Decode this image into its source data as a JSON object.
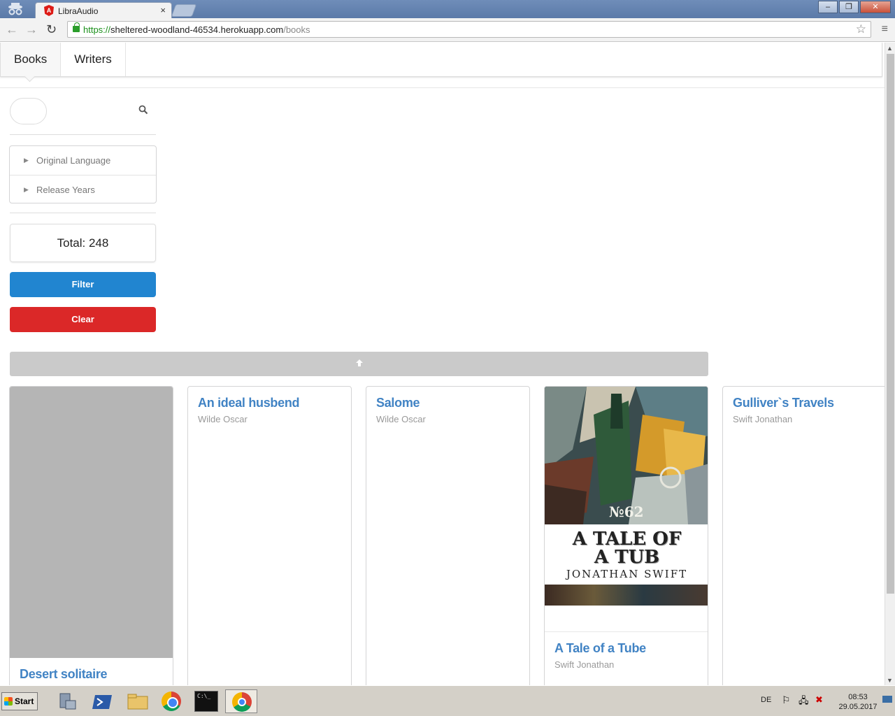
{
  "browser": {
    "tab_title": "LibraAudio",
    "tab_close": "×",
    "url_scheme": "https://",
    "url_host": "sheltered-woodland-46534.herokuapp.com",
    "url_path": "/books"
  },
  "nav": {
    "items": [
      {
        "label": "Books",
        "active": true
      },
      {
        "label": "Writers",
        "active": false
      }
    ]
  },
  "sidebar": {
    "search_placeholder": "",
    "filters": [
      {
        "label": "Original Language"
      },
      {
        "label": "Release Years"
      }
    ],
    "total_label": "Total: 248",
    "filter_button": "Filter",
    "clear_button": "Clear"
  },
  "books": [
    {
      "title": "Desert solitaire",
      "author": "",
      "cover": "gray"
    },
    {
      "title": "An ideal husbend",
      "author": "Wilde Oscar",
      "cover": "none"
    },
    {
      "title": "Salome",
      "author": "Wilde Oscar",
      "cover": "none"
    },
    {
      "title": "A Tale of a Tube",
      "author": "Swift Jonathan",
      "cover": "art",
      "cover_title_line1": "A TALE OF",
      "cover_title_line2": "A TUB",
      "cover_author": "JONATHAN SWIFT",
      "cover_number": "№62"
    },
    {
      "title": "Gulliver`s Travels",
      "author": "Swift Jonathan",
      "cover": "none"
    }
  ],
  "taskbar": {
    "start_label": "Start",
    "language": "DE",
    "time": "08:53",
    "date": "29.05.2017"
  },
  "colors": {
    "primary": "#2185d0",
    "danger": "#db2828",
    "link": "#4183c4"
  }
}
